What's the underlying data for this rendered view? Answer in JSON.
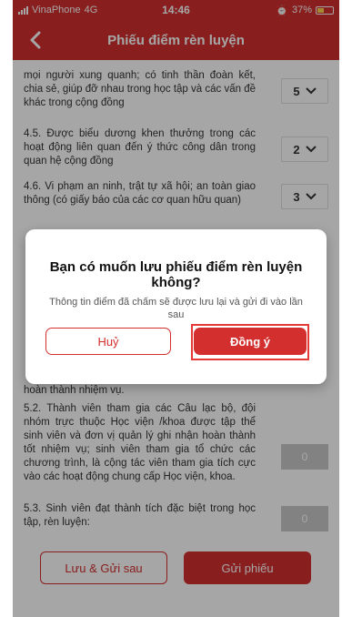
{
  "status": {
    "carrier": "VinaPhone",
    "network": "4G",
    "time": "14:46",
    "battery": "37%"
  },
  "header": {
    "title": "Phiếu điểm rèn luyện",
    "back_icon": "chevron-left-icon"
  },
  "items": [
    {
      "desc": "mọi người xung quanh; có tinh thần đoàn kết, chia sẻ, giúp đỡ nhau trong học tập và các vấn đề khác trong cộng đồng",
      "score": "5"
    },
    {
      "desc": "4.5. Được biểu dương khen thưởng trong các hoạt động liên quan đến ý thức công dân trong quan hệ cộng đồng",
      "score": "2"
    },
    {
      "desc": "4.6. Vi phạm an ninh, trật tự xã hội; an toàn giao thông (có giấy báo của các cơ quan hữu quan)",
      "score": "3"
    },
    {
      "desc": "hoàn thành nhiệm vụ.",
      "score": ""
    },
    {
      "desc": "5.2. Thành viên tham gia các Câu lạc bộ, đội nhóm trực thuộc Học viện /khoa được tập thể sinh viên và đơn vị quản lý ghi nhận hoàn thành tốt nhiệm vụ; sinh viên tham gia tổ chức các chương trình, là cộng tác viên tham gia tích cực vào các hoạt động chung cấp Học viện, khoa.",
      "score": "0"
    },
    {
      "desc": "5.3. Sinh viên đạt thành tích đặc biệt trong học tập, rèn luyện:",
      "score": "0"
    }
  ],
  "dialog": {
    "title": "Bạn có muốn lưu phiếu điểm rèn luyện không?",
    "message": "Thông tin điểm đã chấm sẽ được lưu lại và gửi đi vào lần sau",
    "cancel_label": "Huỷ",
    "ok_label": "Đồng ý"
  },
  "bottom": {
    "save_later_label": "Lưu & Gửi sau",
    "send_label": "Gửi phiếu"
  },
  "colors": {
    "brand": "#d32f2f",
    "highlight": "#e53935"
  }
}
